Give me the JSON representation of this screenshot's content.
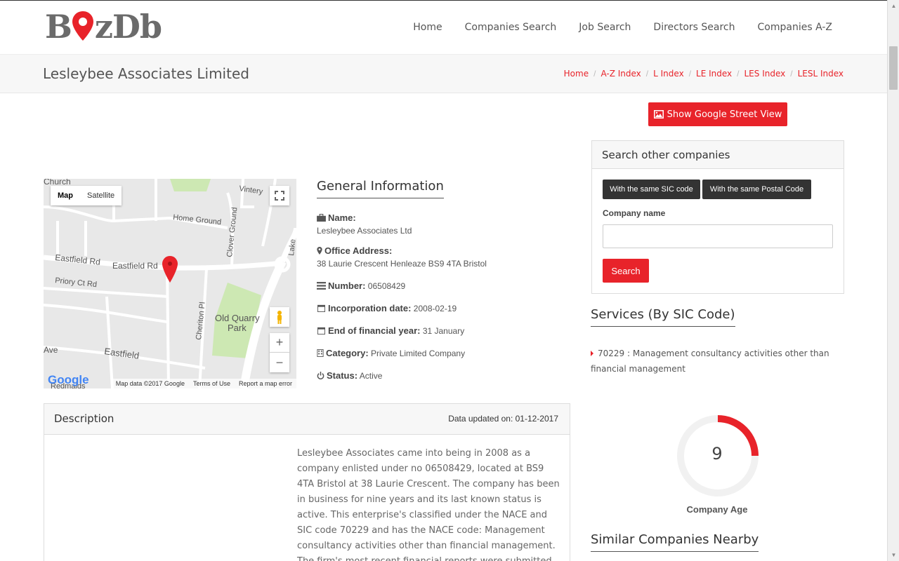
{
  "logo": {
    "before": "B",
    "after": "zDb"
  },
  "nav": [
    "Home",
    "Companies Search",
    "Job Search",
    "Directors Search",
    "Companies A-Z"
  ],
  "page_title": "Lesleybee Associates Limited",
  "breadcrumb": [
    "Home",
    "A-Z Index",
    "L Index",
    "LE Index",
    "LES Index",
    "LESL Index"
  ],
  "street_view_button": "Show Google Street View",
  "map": {
    "type_map": "Map",
    "type_satellite": "Satellite",
    "labels": {
      "church": "Church",
      "vintery": "Vintery",
      "home_ground": "Home Ground",
      "clover_ground": "Clover Ground",
      "eastfield_rd_1": "Eastfield Rd",
      "eastfield_rd_2": "Eastfield Rd",
      "priory": "Priory Ct Rd",
      "cheriton": "Cheriton Pl",
      "old_quarry": "Old Quarry",
      "park": "Park",
      "ave": "Ave",
      "eastfield": "Eastfield",
      "lake": "Lake",
      "redmaids": "Redmaids"
    },
    "google": "Google",
    "attribution": [
      "Map data ©2017 Google",
      "Terms of Use",
      "Report a map error"
    ]
  },
  "general_info": {
    "title": "General Information",
    "name_label": "Name:",
    "name_value": "Lesleybee Associates Ltd",
    "address_label": "Office Address:",
    "address_value": "38 Laurie Crescent Henleaze BS9 4TA Bristol",
    "number_label": "Number:",
    "number_value": "06508429",
    "incorporation_label": "Incorporation date:",
    "incorporation_value": "2008-02-19",
    "fy_label": "End of financial year:",
    "fy_value": "31 January",
    "category_label": "Category:",
    "category_value": "Private Limited Company",
    "status_label": "Status:",
    "status_value": "Active"
  },
  "description": {
    "title": "Description",
    "updated": "Data updated on: 01-12-2017",
    "body": "Lesleybee Associates came into being in 2008 as a company enlisted under no 06508429, located at BS9 4TA Bristol at 38 Laurie Crescent. The company has been in business for nine years and its last known status is active. This enterprise's classified under the NACE and SIC code 70229 and has the NACE code: Management consultancy activities other than financial management. The firm's most recent financial reports were submitted for the period up to"
  },
  "search_panel": {
    "title": "Search other companies",
    "tab_sic": "With the same SIC code",
    "tab_postal": "With the same Postal Code",
    "company_name_label": "Company name",
    "search_button": "Search"
  },
  "services": {
    "title": "Services (By SIC Code)",
    "items": [
      "70229 : Management consultancy activities other than financial management"
    ]
  },
  "company_age": {
    "value": "9",
    "label": "Company Age",
    "fraction": 0.25
  },
  "similar_title": "Similar Companies Nearby",
  "colors": {
    "accent": "#e8232a",
    "dark_button": "#333333"
  }
}
